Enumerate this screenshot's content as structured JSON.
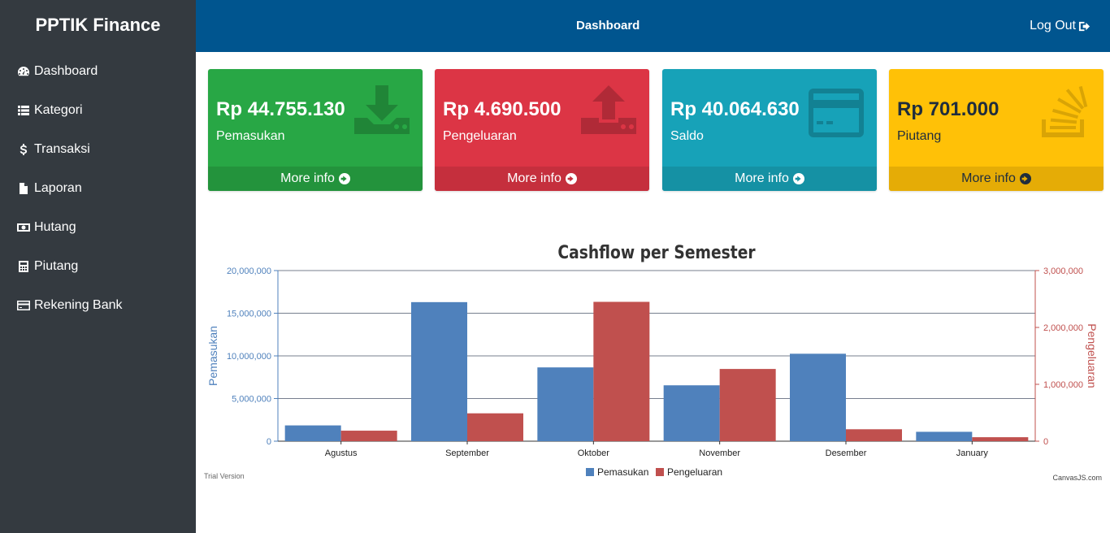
{
  "brand": "PPTIK Finance",
  "sidebar": {
    "items": [
      {
        "label": "Dashboard",
        "icon": "dashboard-icon"
      },
      {
        "label": "Kategori",
        "icon": "list-icon"
      },
      {
        "label": "Transaksi",
        "icon": "dollar-icon"
      },
      {
        "label": "Laporan",
        "icon": "file-icon"
      },
      {
        "label": "Hutang",
        "icon": "money-icon"
      },
      {
        "label": "Piutang",
        "icon": "calculator-icon"
      },
      {
        "label": "Rekening Bank",
        "icon": "credit-card-icon"
      }
    ]
  },
  "header": {
    "title": "Dashboard",
    "logout": "Log Out"
  },
  "cards": [
    {
      "amount": "Rp 44.755.130",
      "label": "Pemasukan",
      "more": "More info",
      "icon": "download-icon",
      "color": "#28a745"
    },
    {
      "amount": "Rp 4.690.500",
      "label": "Pengeluaran",
      "more": "More info",
      "icon": "upload-icon",
      "color": "#dc3545"
    },
    {
      "amount": "Rp 40.064.630",
      "label": "Saldo",
      "more": "More info",
      "icon": "credit-card-icon",
      "color": "#17a2b8"
    },
    {
      "amount": "Rp 701.000",
      "label": "Piutang",
      "more": "More info",
      "icon": "stack-icon",
      "color": "#ffc107"
    }
  ],
  "chart_data": {
    "type": "bar",
    "title": "Cashflow per Semester",
    "categories": [
      "Agustus",
      "September",
      "Oktober",
      "November",
      "Desember",
      "January"
    ],
    "series": [
      {
        "name": "Pemasukan",
        "axis": "left",
        "color": "#4f81bc",
        "values": [
          1850000,
          16300000,
          8650000,
          6550000,
          10250000,
          1100000
        ]
      },
      {
        "name": "Pengeluaran",
        "axis": "right",
        "color": "#c0504e",
        "values": [
          185000,
          490000,
          2450000,
          1270000,
          210000,
          70000
        ]
      }
    ],
    "ylabel": "Pemasukan",
    "y2label": "Pengeluaran",
    "ylim": [
      0,
      20000000
    ],
    "y2lim": [
      0,
      3000000
    ],
    "yticks": [
      "0",
      "5,000,000",
      "10,000,000",
      "15,000,000",
      "20,000,000"
    ],
    "y2ticks": [
      "0",
      "1,000,000",
      "2,000,000",
      "3,000,000"
    ],
    "legend_position": "bottom",
    "grid": true,
    "watermark_left": "Trial Version",
    "watermark_right": "CanvasJS.com"
  }
}
